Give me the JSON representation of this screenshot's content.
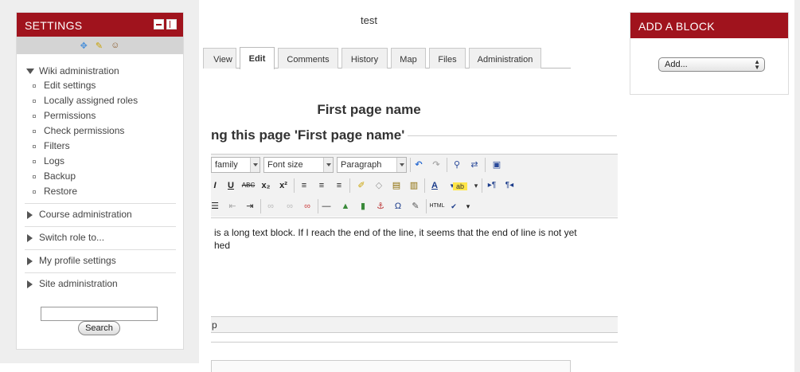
{
  "settings": {
    "title": "SETTINGS",
    "wiki_admin": {
      "label": "Wiki administration",
      "items": [
        "Edit settings",
        "Locally assigned roles",
        "Permissions",
        "Check permissions",
        "Filters",
        "Logs",
        "Backup",
        "Restore"
      ]
    },
    "sections": [
      "Course administration",
      "Switch role to...",
      "My profile settings",
      "Site administration"
    ],
    "search_button": "Search"
  },
  "center": {
    "course_title": "test",
    "tabs": [
      "View",
      "Edit",
      "Comments",
      "History",
      "Map",
      "Files",
      "Administration"
    ],
    "active_tab": "Edit",
    "page_name": "First page name",
    "editing_heading": "ng this page 'First page name'",
    "toolbar": {
      "font_family": "family",
      "font_size": "Font size",
      "format": "Paragraph"
    },
    "editor_text": "is a long text block. If I reach the end of the line, it seems that the end of line is not yet",
    "editor_text2": "hed",
    "status_path": "p"
  },
  "add_block": {
    "title": "ADD A BLOCK",
    "select_value": "Add..."
  },
  "colors": {
    "header_red": "#a0131d",
    "sidebar_bg": "#eeeeee"
  }
}
